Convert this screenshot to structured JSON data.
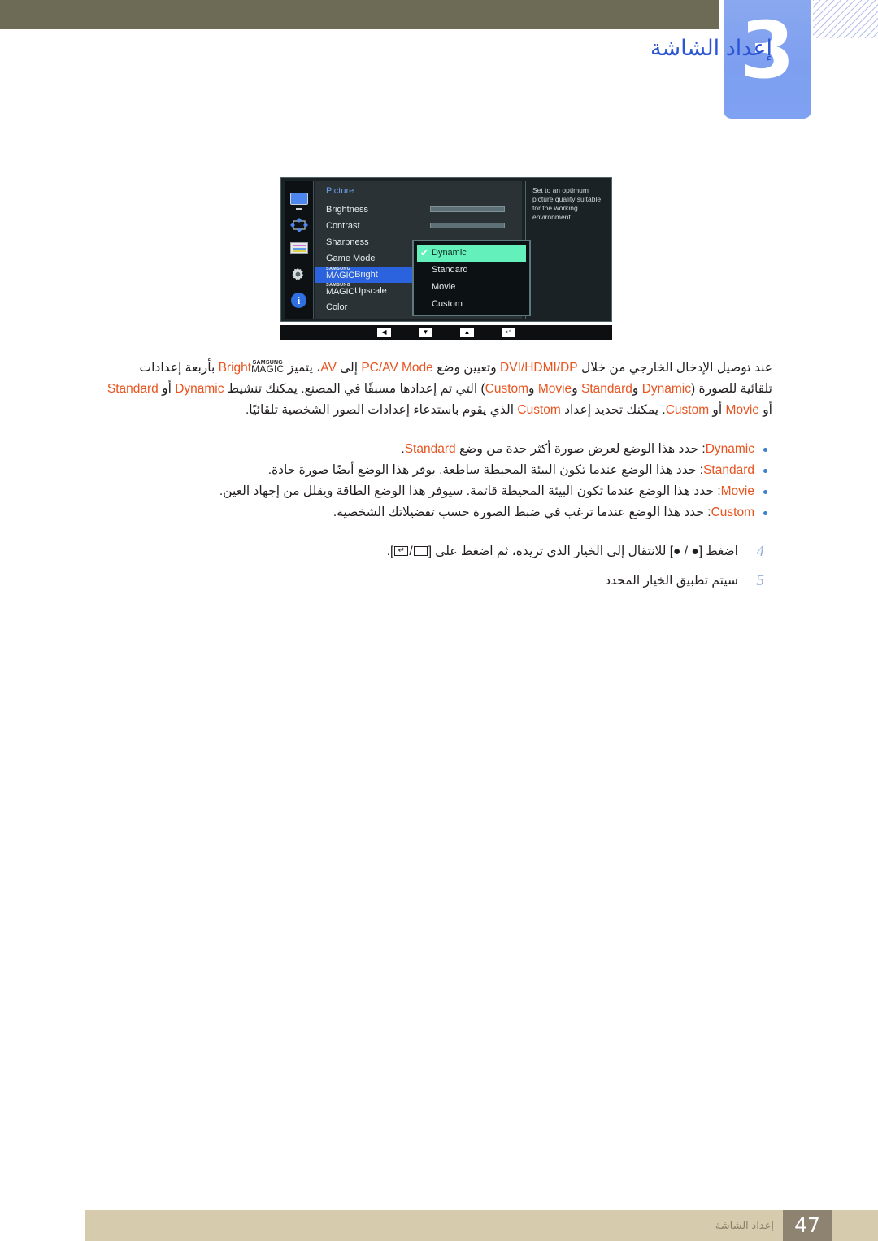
{
  "header": {
    "chapter_number": "3",
    "chapter_title": "إعداد الشاشة"
  },
  "osd": {
    "menu_title": "Picture",
    "rows": [
      {
        "label": "Brightness",
        "value": "100",
        "fill_pct": 100
      },
      {
        "label": "Contrast",
        "value": "75",
        "fill_pct": 75
      },
      {
        "label": "Sharpness",
        "value": "",
        "fill_pct": null
      },
      {
        "label": "Game Mode",
        "value": "",
        "fill_pct": null
      }
    ],
    "magic_rows": [
      {
        "brand_small": "SAMSUNG",
        "brand_big": "MAGIC",
        "suffix": "Bright",
        "highlighted": true
      },
      {
        "brand_small": "SAMSUNG",
        "brand_big": "MAGIC",
        "suffix": "Upscale",
        "highlighted": false
      }
    ],
    "last_row": "Color",
    "help_text": "Set to an optimum picture quality suitable for the working environment.",
    "popup_items": [
      {
        "label": "Dynamic",
        "selected": true
      },
      {
        "label": "Standard",
        "selected": false
      },
      {
        "label": "Movie",
        "selected": false
      },
      {
        "label": "Custom",
        "selected": false
      }
    ],
    "check_glyph": "✔",
    "bottom_keys": [
      "◀",
      "▼",
      "▲",
      "↵"
    ],
    "colors": {
      "highlight_blue": "#2a63dd",
      "selected_green": "#63f0bb",
      "title_blue": "#6d9fe8"
    }
  },
  "paragraph": {
    "line1_a": "عند توصيل الإدخال الخارجي من خلال ",
    "tok_dvi": "DVI/HDMI/DP",
    "line1_b": " وتعيين وضع ",
    "tok_pcav": "PC/AV Mode",
    "line1_c": " إلى ",
    "tok_av": "AV",
    "line1_d": "، يتميز ",
    "magic_small": "SAMSUNG",
    "magic_big": "MAGIC",
    "magic_suffix": "Bright",
    "line1_e": " بأربعة",
    "line2_a": "إعدادات تلقائية للصورة (",
    "tok_dynamic": "Dynamic",
    "line2_b": " و",
    "tok_standard": "Standard",
    "line2_c": " و",
    "tok_movie": "Movie",
    "line2_d": " و",
    "tok_custom": "Custom",
    "line2_e": ") التي تم إعدادها مسبقًا في المصنع. يمكنك تنشيط ",
    "line3_a": " أو ",
    "line3_b": ". يمكنك تحديد إعداد ",
    "line3_c": " الذي يقوم باستدعاء إعدادات الصور الشخصية تلقائيًا."
  },
  "bullets": [
    {
      "token": "Dynamic",
      "text_a": ": حدد هذا الوضع لعرض صورة أكثر حدة من وضع ",
      "token2": "Standard",
      "text_b": "."
    },
    {
      "token": "Standard",
      "text_a": ": حدد هذا الوضع عندما تكون البيئة المحيطة ساطعة. يوفر هذا الوضع أيضًا صورة حادة.",
      "token2": "",
      "text_b": ""
    },
    {
      "token": "Movie",
      "text_a": ": حدد هذا الوضع عندما تكون البيئة المحيطة قاتمة. سيوفر هذا الوضع الطاقة ويقلل من إجهاد العين.",
      "token2": "",
      "text_b": ""
    },
    {
      "token": "Custom",
      "text_a": ": حدد هذا الوضع عندما ترغب في ضبط الصورة حسب تفضيلاتك الشخصية.",
      "token2": "",
      "text_b": ""
    }
  ],
  "steps": [
    {
      "num": "4",
      "text_a": "اضغط [",
      "key_a": "●",
      "mid": " / ",
      "key_b": "●",
      "text_b": "] للانتقال إلى الخيار الذي تريده، ثم اضغط على [",
      "text_c": "]."
    },
    {
      "num": "5",
      "text_a": "سيتم تطبيق الخيار المحدد",
      "key_a": "",
      "mid": "",
      "key_b": "",
      "text_b": "",
      "text_c": ""
    }
  ],
  "footer": {
    "page_number": "47",
    "section_label": "إعداد الشاشة"
  }
}
